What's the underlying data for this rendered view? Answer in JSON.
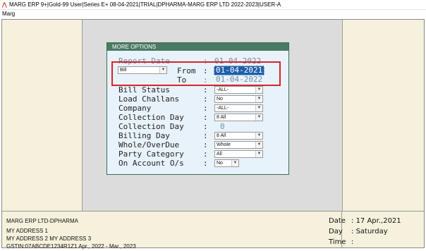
{
  "window": {
    "title": "MARG ERP 9+|Gold-99 User|Series E+ 08-04-2021|TRIAL|DPHARMA-MARG ERP LTD 2022-2023|USER-A",
    "menu": "Marg"
  },
  "dialog": {
    "title": "MORE OPTIONS",
    "report_date": {
      "label": "Report Date",
      "value": "01-04-2022"
    },
    "bill_type": {
      "value": "Bill"
    },
    "from": {
      "label": "From",
      "value": "01-04-2021"
    },
    "to": {
      "label": "To",
      "value": "01-04-2022"
    },
    "bill_status": {
      "label": "Bill Status",
      "value": "-ALL-"
    },
    "load_challans": {
      "label": "Load Challans",
      "value": "No"
    },
    "company": {
      "label": "Company",
      "value": "-ALL-"
    },
    "collection_day_select": {
      "label": "Collection Day",
      "value": "8 All"
    },
    "collection_day_num": {
      "label": "Collection Day",
      "value": "0"
    },
    "billing_day": {
      "label": "Billing Day",
      "value": "8 All"
    },
    "whole_overdue": {
      "label": "Whole/OverDue",
      "value": "Whole"
    },
    "party_category": {
      "label": "Party Category",
      "value": "All"
    },
    "on_account": {
      "label": "On Account O/s",
      "value": "No"
    },
    "colon": ":"
  },
  "footer": {
    "company": "MARG ERP LTD-DPHARMA",
    "address1": "MY ADDRESS 1",
    "address2": "MY ADDRESS 2 MY ADDRESS 3",
    "gstin_period": "GSTIN:07ABCDE1234R1Z1  Apr., 2022 - Mar., 2023",
    "date_label": "Date",
    "date_value": "17 Apr.,2021",
    "day_label": "Day",
    "day_value": "Saturday",
    "time_label": "Time",
    "time_value": "",
    "sep": ":"
  },
  "colors": {
    "dialog_header": "#4a7a63",
    "highlight": "#1f5fa8",
    "annotation": "#d8232a",
    "panel": "#f5f1dc"
  }
}
